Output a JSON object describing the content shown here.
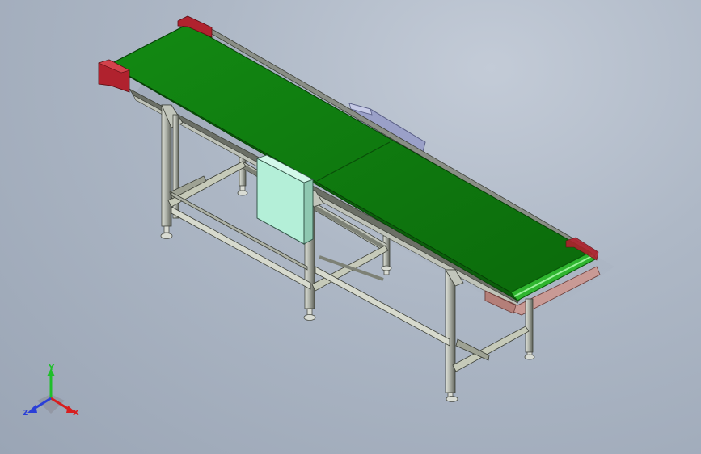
{
  "viewport": {
    "background_top": "#c3cbd7",
    "background_bottom": "#9aa5b5"
  },
  "model": {
    "belt_color": "#0f7a0f",
    "belt_edge_color": "#2fb52f",
    "end_cap_color": "#b0222e",
    "frame_color": "#c8ccc2",
    "control_box_color": "#b4efd8",
    "motor_box_color": "#9aa0c8",
    "tray_color": "#c99a95"
  },
  "triad": {
    "y_label": "Y",
    "z_label": "Z",
    "x_label": "X",
    "y_color": "#1fbf2a",
    "z_color": "#2a3fd8",
    "x_color": "#d81e1e"
  }
}
